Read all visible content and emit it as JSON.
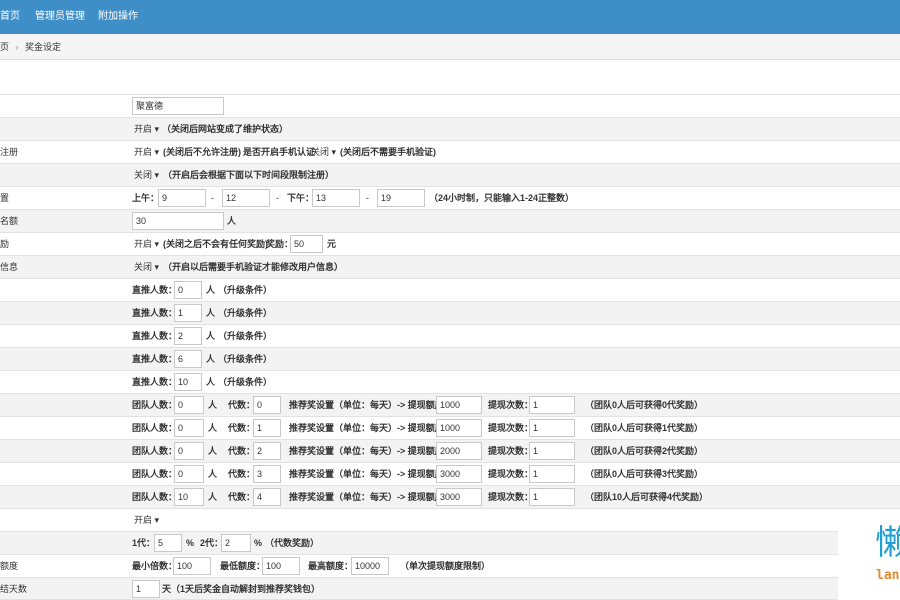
{
  "nav": {
    "home": "首页",
    "admins": "管理员管理",
    "extra": "附加操作"
  },
  "breadcrumb": {
    "root": "页",
    "sep": "›",
    "current": "奖金设定"
  },
  "rows": [
    {
      "label": "",
      "value": "聚富德"
    },
    {
      "label": "",
      "select": "开启",
      "note": "（关闭后网站变成了维护状态）"
    },
    {
      "label": "注册",
      "select": "开启",
      "note": "(关闭后不允许注册)",
      "mid": "是否开启手机认证",
      "select2": "关闭",
      "note2": "(关闭后不需要手机验证)"
    },
    {
      "label": "",
      "select": "关闭",
      "note": "（开启后会根据下面以下时间段限制注册）"
    },
    {
      "label": "置",
      "am": "上午：",
      "am_start": "9",
      "dash1": "-",
      "am_end": "12",
      "dash2": "-",
      "pm": "下午：",
      "pm_start": "13",
      "dash3": "-",
      "pm_end": "19",
      "note": "（24小时制，只能输入1-24正整数）"
    },
    {
      "label": "名额",
      "value": "30",
      "unit": "人"
    },
    {
      "label": "励",
      "select": "开启",
      "note": "(关闭之后不会有任何奖励)",
      "bonus_label": "奖励：",
      "bonus": "50",
      "unit": "元"
    },
    {
      "label": "信息",
      "select": "关闭",
      "note": "（开启以后需要手机验证才能修改用户信息）"
    }
  ],
  "upgrade_rows": [
    {
      "label": "直推人数：",
      "value": "0",
      "unit": "人",
      "note": "（升级条件）"
    },
    {
      "label": "直推人数：",
      "value": "1",
      "unit": "人",
      "note": "（升级条件）"
    },
    {
      "label": "直推人数：",
      "value": "2",
      "unit": "人",
      "note": "（升级条件）"
    },
    {
      "label": "直推人数：",
      "value": "6",
      "unit": "人",
      "note": "（升级条件）"
    },
    {
      "label": "直推人数：",
      "value": "10",
      "unit": "人",
      "note": "（升级条件）"
    }
  ],
  "team_rows": [
    {
      "team_label": "团队人数：",
      "team": "0",
      "unit": "人",
      "gen_label": "代数：",
      "gen": "0",
      "rec_label": "推荐奖设置（单位：每天）-> 提现额度：",
      "limit": "1000",
      "times_label": "提现次数：",
      "times": "1",
      "note": "（团队0人后可获得0代奖励）"
    },
    {
      "team_label": "团队人数：",
      "team": "0",
      "unit": "人",
      "gen_label": "代数：",
      "gen": "1",
      "rec_label": "推荐奖设置（单位：每天）-> 提现额度：",
      "limit": "1000",
      "times_label": "提现次数：",
      "times": "1",
      "note": "（团队0人后可获得1代奖励）"
    },
    {
      "team_label": "团队人数：",
      "team": "0",
      "unit": "人",
      "gen_label": "代数：",
      "gen": "2",
      "rec_label": "推荐奖设置（单位：每天）-> 提现额度：",
      "limit": "2000",
      "times_label": "提现次数：",
      "times": "1",
      "note": "（团队0人后可获得2代奖励）"
    },
    {
      "team_label": "团队人数：",
      "team": "0",
      "unit": "人",
      "gen_label": "代数：",
      "gen": "3",
      "rec_label": "推荐奖设置（单位：每天）-> 提现额度：",
      "limit": "3000",
      "times_label": "提现次数：",
      "times": "1",
      "note": "（团队0人后可获得3代奖励）"
    },
    {
      "team_label": "团队人数：",
      "team": "10",
      "unit": "人",
      "gen_label": "代数：",
      "gen": "4",
      "rec_label": "推荐奖设置（单位：每天）-> 提现额度：",
      "limit": "3000",
      "times_label": "提现次数：",
      "times": "1",
      "note": "（团队10人后可获得4代奖励）"
    }
  ],
  "tail": {
    "select": "开启",
    "gen1_label": "1代：",
    "gen1": "5",
    "pct1": "%",
    "gen2_label": "2代：",
    "gen2": "2",
    "pct2": "%",
    "gen_note": "（代数奖励）",
    "fee_label": "额度",
    "min_mult_label": "最小倍数：",
    "min_mult": "100",
    "min_amt_label": "最低额度：",
    "min_amt": "100",
    "max_amt_label": "最高额度：",
    "max_amt": "10000",
    "fee_note": "（单次提现额度限制）",
    "days_label": "结天数",
    "days": "1",
    "days_note": "天（1天后奖金自动解封到推荐奖钱包）"
  },
  "watermark": {
    "char": "懒",
    "text": "lan"
  },
  "colors": {
    "topbar": "#3e8fc7",
    "watermark_blue": "#1e9fd6",
    "watermark_orange": "#e5892c"
  }
}
